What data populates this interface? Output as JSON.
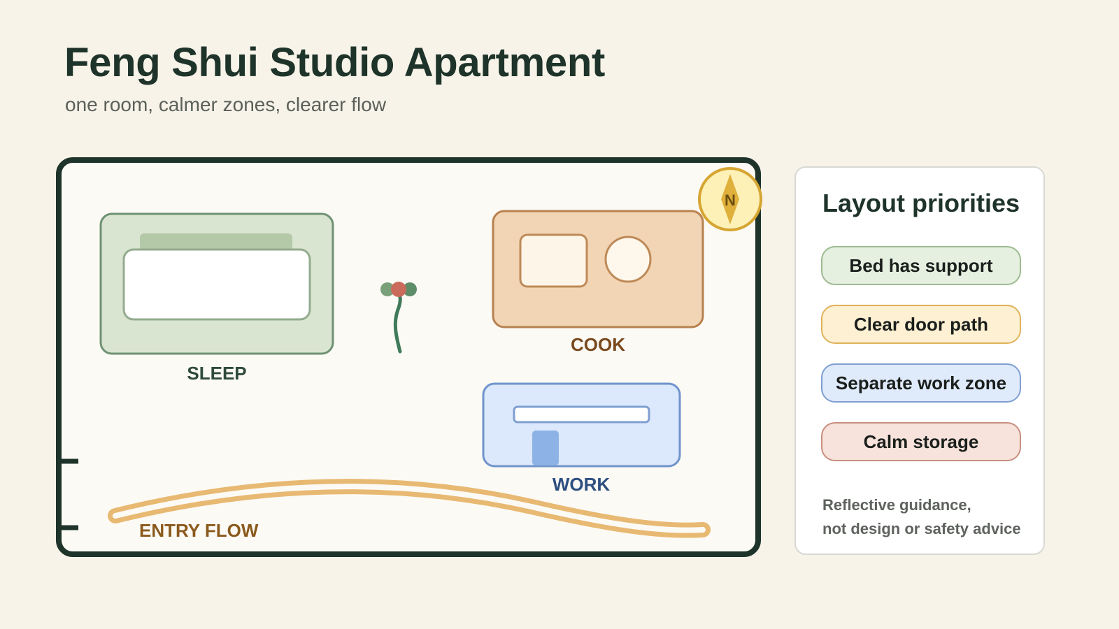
{
  "header": {
    "title": "Feng Shui Studio Apartment",
    "subtitle": "one room, calmer zones, clearer flow"
  },
  "floor_plan": {
    "zones": {
      "sleep": "SLEEP",
      "cook": "COOK",
      "work": "WORK",
      "entry": "ENTRY FLOW"
    },
    "compass": "N"
  },
  "panel": {
    "title": "Layout priorities",
    "items": [
      {
        "label": "Bed has support",
        "fill": "#e6f0e1",
        "border": "#9dbb90"
      },
      {
        "label": "Clear door path",
        "fill": "#fdf0d3",
        "border": "#e0b25a"
      },
      {
        "label": "Separate work zone",
        "fill": "#dfeafb",
        "border": "#7f9fd1"
      },
      {
        "label": "Calm storage",
        "fill": "#f7e3dc",
        "border": "#c88f80"
      }
    ],
    "note_line1": "Reflective guidance,",
    "note_line2": "not design or safety advice"
  },
  "colors": {
    "ink": "#1e3329",
    "sleep": "#dae5d1",
    "cook": "#f2d5b4",
    "work": "#dce8fb",
    "flow": "#e8b972",
    "compass": "#fdf1b8"
  }
}
